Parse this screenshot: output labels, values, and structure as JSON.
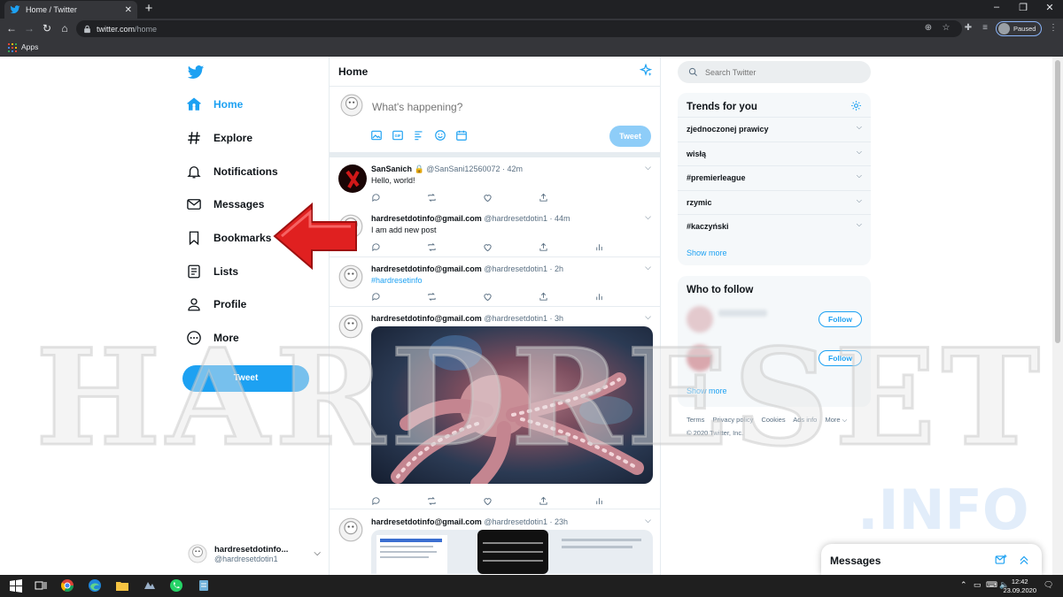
{
  "browser": {
    "tab_title": "Home / Twitter",
    "tab_close": "✕",
    "new_tab": "+",
    "url_host": "twitter.com",
    "url_path": "/home",
    "profile_status": "Paused",
    "bookmarks_apps": "Apps",
    "window_controls": [
      "–",
      "❐",
      "✕"
    ]
  },
  "nav": {
    "items": [
      {
        "label": "Home",
        "icon": "home-icon",
        "active": true
      },
      {
        "label": "Explore",
        "icon": "hashtag-icon"
      },
      {
        "label": "Notifications",
        "icon": "bell-icon"
      },
      {
        "label": "Messages",
        "icon": "mail-icon"
      },
      {
        "label": "Bookmarks",
        "icon": "bookmark-icon"
      },
      {
        "label": "Lists",
        "icon": "list-icon"
      },
      {
        "label": "Profile",
        "icon": "person-icon"
      },
      {
        "label": "More",
        "icon": "more-dots-icon"
      }
    ],
    "tweet_button": "Tweet",
    "account_name": "hardresetdotinfo...",
    "account_handle": "@hardresetdotin1"
  },
  "timeline": {
    "title": "Home",
    "composer_placeholder": "What's happening?",
    "composer_tweet": "Tweet",
    "tweets": [
      {
        "name": "SanSanich",
        "meta": "@SanSani12560072 · 42m",
        "text": "Hello, world!"
      },
      {
        "name": "hardresetdotinfo@gmail.com",
        "meta": "@hardresetdotin1 · 44m",
        "text": "I am add new post"
      },
      {
        "name": "hardresetdotinfo@gmail.com",
        "meta": "@hardresetdotin1 · 2h",
        "text": "#hardresetinfo"
      },
      {
        "name": "hardresetdotinfo@gmail.com",
        "meta": "@hardresetdotin1 · 3h",
        "text": ""
      },
      {
        "name": "hardresetdotinfo@gmail.com",
        "meta": "@hardresetdotin1 · 23h",
        "text": ""
      }
    ]
  },
  "sidebar": {
    "search_placeholder": "Search Twitter",
    "trends_title": "Trends for you",
    "trends": [
      "zjednoczonej prawicy",
      "wisłą",
      "#premierleague",
      "rzymic",
      "#kaczyński"
    ],
    "trends_show_more": "Show more",
    "follow_title": "Who to follow",
    "follow_button": "Follow",
    "follow_show_more": "Show more",
    "footer_links": [
      "Terms",
      "Privacy policy",
      "Cookies",
      "Ads info",
      "More ⌵"
    ],
    "copyright": "© 2020 Twitter, Inc."
  },
  "messages_drawer": {
    "title": "Messages"
  },
  "watermark": {
    "main": "HARDRESET",
    "sub": ".INFO"
  },
  "taskbar": {
    "time": "12:42",
    "date": "23.09.2020"
  },
  "colors": {
    "accent": "#1da1f2",
    "arrow": "#e02020"
  }
}
